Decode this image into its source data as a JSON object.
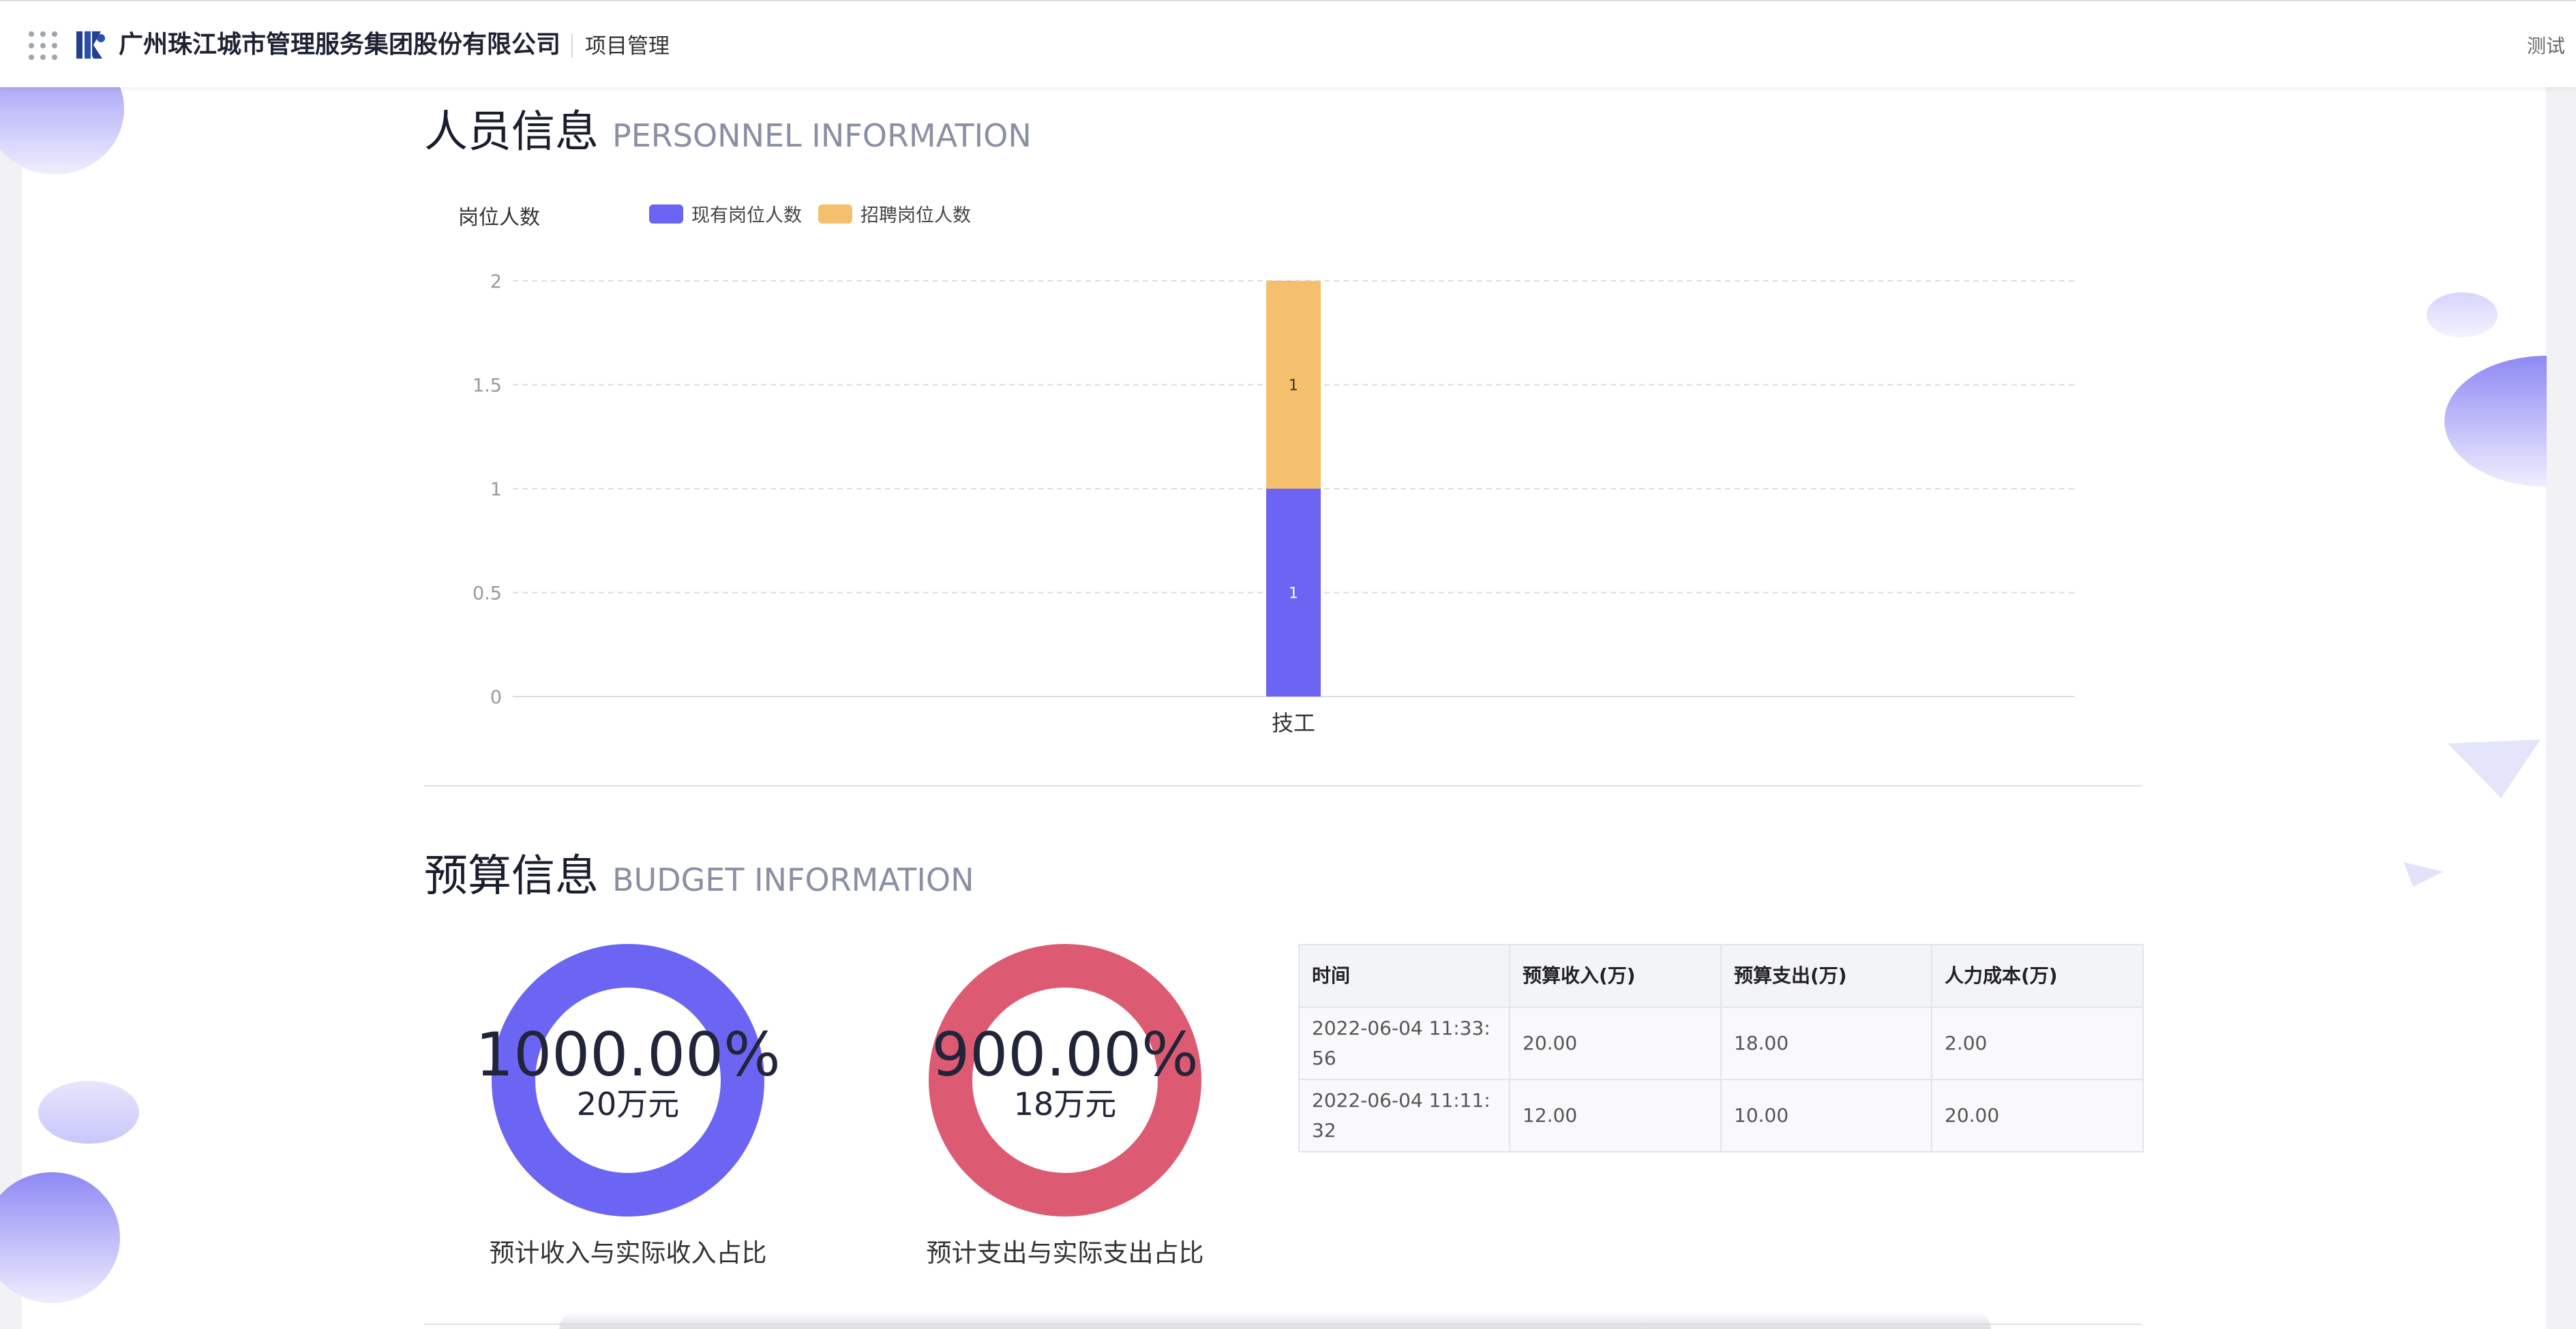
{
  "header": {
    "company": "广州珠江城市管理服务集团股份有限公司",
    "module": "项目管理",
    "user": "测试"
  },
  "personnel": {
    "title_zh": "人员信息",
    "title_en": "PERSONNEL INFORMATION"
  },
  "chart_data": {
    "type": "bar",
    "stacked": true,
    "ylabel": "岗位人数",
    "categories": [
      "技工"
    ],
    "series": [
      {
        "name": "现有岗位人数",
        "values": [
          1
        ],
        "color": "#6c65f3"
      },
      {
        "name": "招聘岗位人数",
        "values": [
          1
        ],
        "color": "#f4c06e"
      }
    ],
    "ylim": [
      0,
      2
    ],
    "yticks": [
      "0",
      "0.5",
      "1",
      "1.5",
      "2"
    ],
    "data_labels": [
      "1",
      "1"
    ],
    "grid": true,
    "legend_position": "top-left"
  },
  "budget": {
    "title_zh": "预算信息",
    "title_en": "BUDGET INFORMATION",
    "donuts": [
      {
        "percent": "1000.00%",
        "amount": "20万元",
        "label": "预计收入与实际收入占比",
        "color": "#6c65f3"
      },
      {
        "percent": "900.00%",
        "amount": "18万元",
        "label": "预计支出与实际支出占比",
        "color": "#dd5b72"
      }
    ],
    "table": {
      "columns": [
        "时间",
        "预算收入(万)",
        "预算支出(万)",
        "人力成本(万)"
      ],
      "rows": [
        [
          "2022-06-04 11:33:56",
          "20.00",
          "18.00",
          "2.00"
        ],
        [
          "2022-06-04 11:11:32",
          "12.00",
          "10.00",
          "20.00"
        ]
      ]
    }
  }
}
